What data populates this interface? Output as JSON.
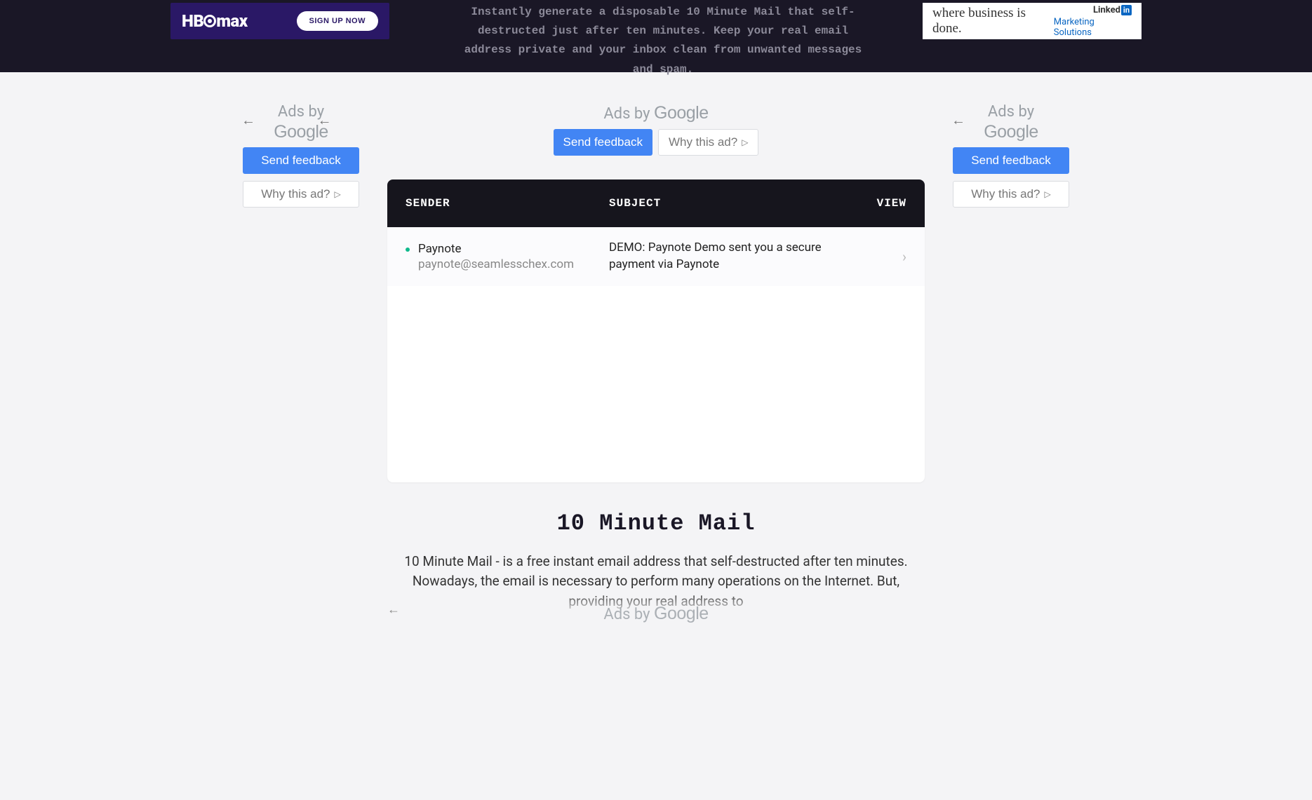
{
  "hero": {
    "hbo_label": "HBOMAX",
    "signup_label": "SIGN UP NOW",
    "desc": "Instantly generate a disposable 10 Minute Mail that self-destructed just after ten minutes. Keep your real email address private and your inbox clean from unwanted messages and spam.",
    "li_tagline": "where business is done.",
    "li_linked": "Linked",
    "li_in": "in",
    "li_ms": "Marketing Solutions"
  },
  "ads": {
    "ads_by": "Ads by",
    "google": "Google",
    "feedback": "Send feedback",
    "whythis": "Why this ad?"
  },
  "inbox": {
    "headers": {
      "sender": "SENDER",
      "subject": "SUBJECT",
      "view": "VIEW"
    },
    "rows": [
      {
        "sender": "Paynote",
        "email": "paynote@seamlesschex.com",
        "subject": "DEMO: Paynote Demo sent you a secure payment via Paynote"
      }
    ]
  },
  "about": {
    "title": "10 Minute Mail",
    "body": "10 Minute Mail - is a free instant email address that self-destructed after ten minutes. Nowadays, the email is necessary to perform many operations on the Internet. But, providing your real address to"
  }
}
